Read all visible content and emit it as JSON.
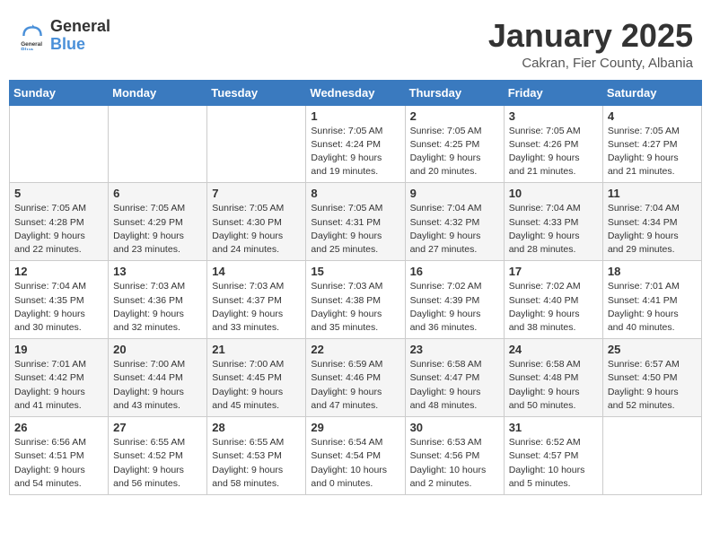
{
  "logo": {
    "general": "General",
    "blue": "Blue"
  },
  "header": {
    "month": "January 2025",
    "location": "Cakran, Fier County, Albania"
  },
  "weekdays": [
    "Sunday",
    "Monday",
    "Tuesday",
    "Wednesday",
    "Thursday",
    "Friday",
    "Saturday"
  ],
  "weeks": [
    [
      null,
      null,
      null,
      {
        "day": "1",
        "sunrise": "7:05 AM",
        "sunset": "4:24 PM",
        "daylight": "9 hours and 19 minutes."
      },
      {
        "day": "2",
        "sunrise": "7:05 AM",
        "sunset": "4:25 PM",
        "daylight": "9 hours and 20 minutes."
      },
      {
        "day": "3",
        "sunrise": "7:05 AM",
        "sunset": "4:26 PM",
        "daylight": "9 hours and 21 minutes."
      },
      {
        "day": "4",
        "sunrise": "7:05 AM",
        "sunset": "4:27 PM",
        "daylight": "9 hours and 21 minutes."
      }
    ],
    [
      {
        "day": "5",
        "sunrise": "7:05 AM",
        "sunset": "4:28 PM",
        "daylight": "9 hours and 22 minutes."
      },
      {
        "day": "6",
        "sunrise": "7:05 AM",
        "sunset": "4:29 PM",
        "daylight": "9 hours and 23 minutes."
      },
      {
        "day": "7",
        "sunrise": "7:05 AM",
        "sunset": "4:30 PM",
        "daylight": "9 hours and 24 minutes."
      },
      {
        "day": "8",
        "sunrise": "7:05 AM",
        "sunset": "4:31 PM",
        "daylight": "9 hours and 25 minutes."
      },
      {
        "day": "9",
        "sunrise": "7:04 AM",
        "sunset": "4:32 PM",
        "daylight": "9 hours and 27 minutes."
      },
      {
        "day": "10",
        "sunrise": "7:04 AM",
        "sunset": "4:33 PM",
        "daylight": "9 hours and 28 minutes."
      },
      {
        "day": "11",
        "sunrise": "7:04 AM",
        "sunset": "4:34 PM",
        "daylight": "9 hours and 29 minutes."
      }
    ],
    [
      {
        "day": "12",
        "sunrise": "7:04 AM",
        "sunset": "4:35 PM",
        "daylight": "9 hours and 30 minutes."
      },
      {
        "day": "13",
        "sunrise": "7:03 AM",
        "sunset": "4:36 PM",
        "daylight": "9 hours and 32 minutes."
      },
      {
        "day": "14",
        "sunrise": "7:03 AM",
        "sunset": "4:37 PM",
        "daylight": "9 hours and 33 minutes."
      },
      {
        "day": "15",
        "sunrise": "7:03 AM",
        "sunset": "4:38 PM",
        "daylight": "9 hours and 35 minutes."
      },
      {
        "day": "16",
        "sunrise": "7:02 AM",
        "sunset": "4:39 PM",
        "daylight": "9 hours and 36 minutes."
      },
      {
        "day": "17",
        "sunrise": "7:02 AM",
        "sunset": "4:40 PM",
        "daylight": "9 hours and 38 minutes."
      },
      {
        "day": "18",
        "sunrise": "7:01 AM",
        "sunset": "4:41 PM",
        "daylight": "9 hours and 40 minutes."
      }
    ],
    [
      {
        "day": "19",
        "sunrise": "7:01 AM",
        "sunset": "4:42 PM",
        "daylight": "9 hours and 41 minutes."
      },
      {
        "day": "20",
        "sunrise": "7:00 AM",
        "sunset": "4:44 PM",
        "daylight": "9 hours and 43 minutes."
      },
      {
        "day": "21",
        "sunrise": "7:00 AM",
        "sunset": "4:45 PM",
        "daylight": "9 hours and 45 minutes."
      },
      {
        "day": "22",
        "sunrise": "6:59 AM",
        "sunset": "4:46 PM",
        "daylight": "9 hours and 47 minutes."
      },
      {
        "day": "23",
        "sunrise": "6:58 AM",
        "sunset": "4:47 PM",
        "daylight": "9 hours and 48 minutes."
      },
      {
        "day": "24",
        "sunrise": "6:58 AM",
        "sunset": "4:48 PM",
        "daylight": "9 hours and 50 minutes."
      },
      {
        "day": "25",
        "sunrise": "6:57 AM",
        "sunset": "4:50 PM",
        "daylight": "9 hours and 52 minutes."
      }
    ],
    [
      {
        "day": "26",
        "sunrise": "6:56 AM",
        "sunset": "4:51 PM",
        "daylight": "9 hours and 54 minutes."
      },
      {
        "day": "27",
        "sunrise": "6:55 AM",
        "sunset": "4:52 PM",
        "daylight": "9 hours and 56 minutes."
      },
      {
        "day": "28",
        "sunrise": "6:55 AM",
        "sunset": "4:53 PM",
        "daylight": "9 hours and 58 minutes."
      },
      {
        "day": "29",
        "sunrise": "6:54 AM",
        "sunset": "4:54 PM",
        "daylight": "10 hours and 0 minutes."
      },
      {
        "day": "30",
        "sunrise": "6:53 AM",
        "sunset": "4:56 PM",
        "daylight": "10 hours and 2 minutes."
      },
      {
        "day": "31",
        "sunrise": "6:52 AM",
        "sunset": "4:57 PM",
        "daylight": "10 hours and 5 minutes."
      },
      null
    ]
  ],
  "labels": {
    "sunrise": "Sunrise:",
    "sunset": "Sunset:",
    "daylight": "Daylight:"
  }
}
